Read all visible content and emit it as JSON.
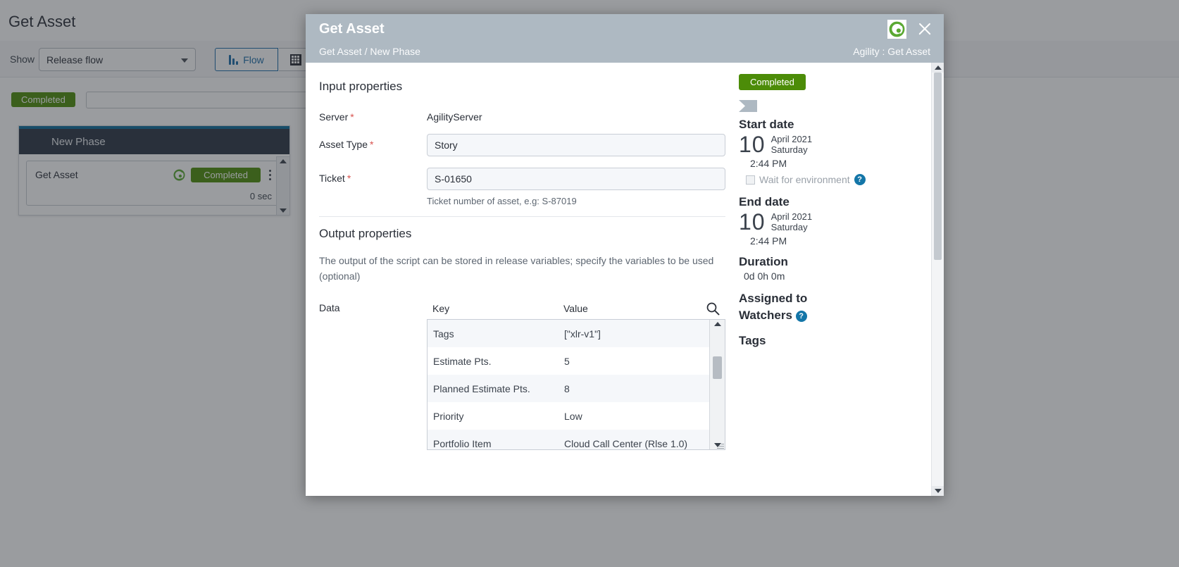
{
  "background": {
    "page_title": "Get Asset",
    "show_label": "Show",
    "flow_select_value": "Release flow",
    "flow_button_label": "Flow",
    "grid_button_label": "grid-view",
    "status_badge": "Completed",
    "phase": {
      "name": "New Phase",
      "task_name": "Get Asset",
      "task_status": "Completed",
      "task_duration": "0 sec"
    }
  },
  "modal": {
    "title": "Get Asset",
    "breadcrumb": "Get Asset / New Phase",
    "context": "Agility : Get Asset",
    "close_label": "close",
    "input_section": {
      "heading": "Input properties",
      "fields": [
        {
          "label": "Server",
          "required": "*",
          "value": "AgilityServer",
          "type": "static"
        },
        {
          "label": "Asset Type",
          "required": "*",
          "value": "Story",
          "type": "input"
        },
        {
          "label": "Ticket",
          "required": "*",
          "value": "S-01650",
          "type": "input",
          "hint": "Ticket number of asset, e.g: S-87019"
        }
      ]
    },
    "output_section": {
      "heading": "Output properties",
      "description": "The output of the script can be stored in release variables; specify the variables to be used (optional)",
      "data_label": "Data",
      "columns": {
        "key": "Key",
        "value": "Value"
      },
      "rows": [
        {
          "key": "Tags",
          "value": "[\"xlr-v1\"]"
        },
        {
          "key": "Estimate Pts.",
          "value": "5"
        },
        {
          "key": "Planned Estimate Pts.",
          "value": "8"
        },
        {
          "key": "Priority",
          "value": "Low"
        },
        {
          "key": "Portfolio Item",
          "value": "Cloud Call Center (Rlse 1.0)"
        }
      ]
    },
    "sidebar": {
      "status": "Completed",
      "start_date_heading": "Start date",
      "start_day": "10",
      "start_month_year": "April 2021",
      "start_weekday": "Saturday",
      "start_time": "2:44 PM",
      "wait_for_environment_label": "Wait for environment",
      "end_date_heading": "End date",
      "end_day": "10",
      "end_month_year": "April 2021",
      "end_weekday": "Saturday",
      "end_time": "2:44 PM",
      "duration_heading": "Duration",
      "duration_value": "0d 0h 0m",
      "assigned_to_heading": "Assigned to",
      "watchers_heading": "Watchers",
      "tags_heading": "Tags",
      "help_glyph": "?"
    }
  },
  "colors": {
    "accent_green": "#4c8c08",
    "header_grey": "#aeb9c2",
    "help_blue": "#1476a8",
    "required_red": "#d9534f",
    "phase_navy": "#2b3342"
  }
}
